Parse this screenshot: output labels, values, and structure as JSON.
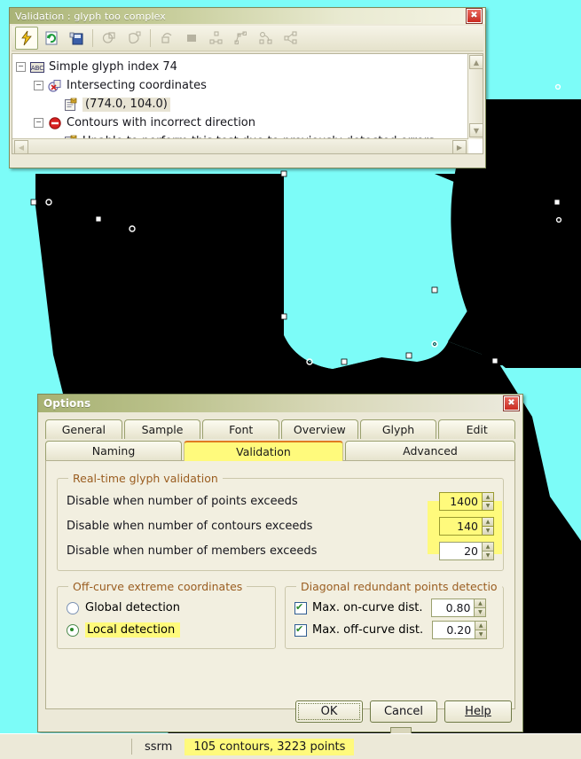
{
  "canvas": {
    "background_color": "#7cfcf8",
    "glyph_color": "#000000",
    "point_color": "#ffffff"
  },
  "validation_window": {
    "title": "Validation : glyph too complex",
    "close_label": "✖",
    "toolbar": [
      {
        "name": "run-validation-icon",
        "glyph": "⚡",
        "active": true,
        "enabled": true
      },
      {
        "name": "refresh-icon",
        "glyph": "↻",
        "active": false,
        "enabled": true
      },
      {
        "name": "save-report-icon",
        "glyph": "💾",
        "active": false,
        "enabled": true
      },
      {
        "name": "contour-test-icon",
        "glyph": "◔",
        "active": false,
        "enabled": false
      },
      {
        "name": "point-test-icon",
        "glyph": "○",
        "active": false,
        "enabled": false
      },
      {
        "name": "transform-icon",
        "glyph": "□",
        "active": false,
        "enabled": false
      },
      {
        "name": "bbox-icon",
        "glyph": "■",
        "active": false,
        "enabled": false
      },
      {
        "name": "nodes-icon",
        "glyph": "∴",
        "active": false,
        "enabled": false
      },
      {
        "name": "vector-icon",
        "glyph": "△",
        "active": false,
        "enabled": false
      },
      {
        "name": "curve-nodes-icon",
        "glyph": "∿",
        "active": false,
        "enabled": false
      },
      {
        "name": "graph-icon",
        "glyph": "⋄",
        "active": false,
        "enabled": false
      }
    ],
    "tree": [
      {
        "level": 0,
        "expander": "−",
        "icon": "abc-glyph-icon",
        "label": "Simple glyph index 74",
        "selected": false
      },
      {
        "level": 1,
        "expander": "−",
        "icon": "intersect-warning-icon",
        "label": "Intersecting coordinates",
        "selected": false
      },
      {
        "level": 2,
        "expander": "",
        "icon": "report-note-icon",
        "label": "(774.0, 104.0)",
        "selected": true
      },
      {
        "level": 1,
        "expander": "−",
        "icon": "error-stop-icon",
        "label": "Contours with incorrect direction",
        "selected": false
      },
      {
        "level": 2,
        "expander": "",
        "icon": "report-note-icon",
        "label": "Unable to perform this test due to previously detected errors",
        "selected": false
      }
    ],
    "scroll": {
      "up": "▲",
      "down": "▼",
      "left": "◀",
      "right": "▶"
    }
  },
  "options_dialog": {
    "title": "Options",
    "close_label": "✖",
    "tabs_row1": [
      {
        "label": "General",
        "selected": false
      },
      {
        "label": "Sample",
        "selected": false
      },
      {
        "label": "Font",
        "selected": false
      },
      {
        "label": "Overview",
        "selected": false
      },
      {
        "label": "Glyph",
        "selected": false
      },
      {
        "label": "Edit",
        "selected": false
      }
    ],
    "tabs_row2": [
      {
        "label": "Naming",
        "selected": false
      },
      {
        "label": "Validation",
        "selected": true
      },
      {
        "label": "Advanced",
        "selected": false
      }
    ],
    "realtime_group": {
      "legend": "Real-time glyph validation",
      "rows": [
        {
          "label": "Disable when number of points exceeds",
          "value": "1400",
          "highlighted": true
        },
        {
          "label": "Disable when number of contours exceeds",
          "value": "140",
          "highlighted": true
        },
        {
          "label": "Disable when number of members exceeds",
          "value": "20",
          "highlighted": false
        }
      ]
    },
    "offcurve_group": {
      "legend": "Off-curve extreme coordinates",
      "options": [
        {
          "label": "Global detection",
          "selected": false,
          "highlighted": false
        },
        {
          "label": "Local detection",
          "selected": true,
          "highlighted": true
        }
      ]
    },
    "diagonal_group": {
      "legend": "Diagonal redundant points detectio",
      "rows": [
        {
          "label": "Max. on-curve dist.",
          "checked": true,
          "value": "0.80"
        },
        {
          "label": "Max. off-curve dist.",
          "checked": true,
          "value": "0.20"
        }
      ]
    },
    "buttons": [
      {
        "label": "OK",
        "focused": true,
        "mnemonic": ""
      },
      {
        "label": "Cancel",
        "focused": false,
        "mnemonic": ""
      },
      {
        "label": "Help",
        "focused": false,
        "mnemonic": "H"
      }
    ],
    "spin_up": "▲",
    "spin_down": "▼"
  },
  "statusbar": {
    "field1": "ssrm",
    "field2": "105 contours, 3223 points",
    "field2_highlighted": true
  }
}
